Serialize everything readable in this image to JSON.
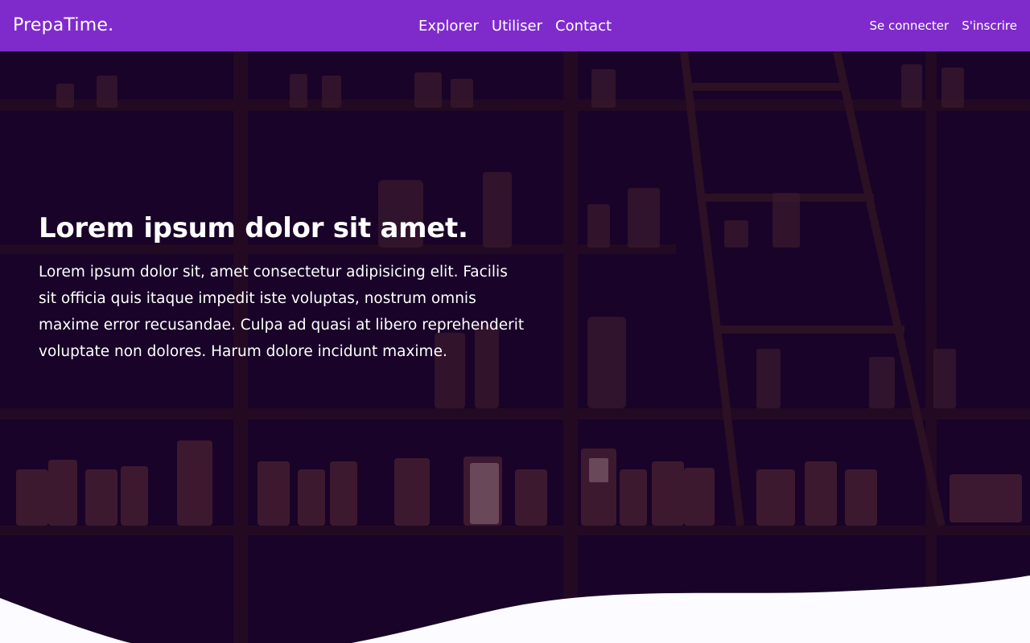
{
  "navbar": {
    "brand": "PrepaTime.",
    "links": [
      "Explorer",
      "Utiliser",
      "Contact"
    ],
    "auth": {
      "login": "Se connecter",
      "signup": "S'inscrire"
    }
  },
  "hero": {
    "title": "Lorem ipsum dolor sit amet.",
    "text": "Lorem ipsum dolor sit, amet consectetur adipisicing elit. Facilis sit officia quis itaque impedit iste voluptas, nostrum omnis maxime error recusandae. Culpa ad quasi at libero reprehenderit voluptate non dolores. Harum dolore incidunt maxime."
  },
  "colors": {
    "navbar_bg": "#7f2bcb",
    "hero_overlay": "#1a0428",
    "page_bg": "#fcfbff",
    "text": "#ffffff"
  }
}
